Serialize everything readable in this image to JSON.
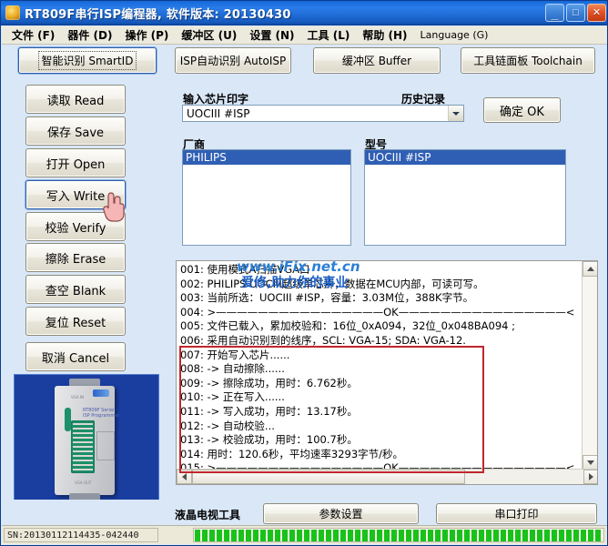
{
  "window": {
    "title": "RT809F串行ISP编程器, 软件版本: 20130430",
    "icon": "app-icon",
    "minimize_label": "_",
    "maximize_label": "□",
    "close_label": "✕"
  },
  "menubar": {
    "items": [
      {
        "label": "文件 (F)",
        "latin": false
      },
      {
        "label": "器件 (D)",
        "latin": false
      },
      {
        "label": "操作 (P)",
        "latin": false
      },
      {
        "label": "缓冲区 (U)",
        "latin": false
      },
      {
        "label": "设置 (N)",
        "latin": false
      },
      {
        "label": "工具 (L)",
        "latin": false
      },
      {
        "label": "帮助 (H)",
        "latin": false
      },
      {
        "label": "Language (G)",
        "latin": true
      }
    ]
  },
  "toolbar": {
    "smartid": "智能识别 SmartID",
    "autoisp": "ISP自动识别 AutoISP",
    "buffer": "缓冲区 Buffer",
    "toolchain": "工具链面板 Toolchain"
  },
  "sidebar": {
    "buttons": [
      {
        "label": "读取 Read"
      },
      {
        "label": "保存 Save"
      },
      {
        "label": "打开 Open"
      },
      {
        "label": "写入 Write"
      },
      {
        "label": "校验 Verify"
      },
      {
        "label": "擦除 Erase"
      },
      {
        "label": "查空 Blank"
      },
      {
        "label": "复位 Reset"
      },
      {
        "label": "取消 Cancel"
      }
    ]
  },
  "chip_panel": {
    "input_label": "输入芯片印字",
    "history_label": "历史记录",
    "combo_value": "UOCIII #ISP",
    "ok_button": "确定 OK",
    "vendor_label": "厂商",
    "model_label": "型号",
    "vendors": [
      "PHILIPS"
    ],
    "vendor_selected": "PHILIPS",
    "models": [
      "UOCIII #ISP"
    ],
    "model_selected": "UOCIII #ISP"
  },
  "log": {
    "watermark_line1": "www.iFix.net.cn",
    "watermark_line2": "爱修,助力你的事业",
    "lines": [
      "001: 使用模式A扫描VGA口",
      "002: PHILIPS UOCIII超级单芯片，数据在MCU内部，可读可写。",
      "003: 当前所选：UOCIII #ISP，容量：3.03M位，388K字节。",
      "004: >————————————————OK————————————————<",
      "005: 文件已载入，累加校验和：16位_0xA094，32位_0x048BA094 ;",
      "006: 采用自动识别到的线序，SCL: VGA-15; SDA: VGA-12.",
      "007: 开始写入芯片......",
      "008: -> 自动擦除......",
      "009: -> 擦除成功，用时：6.762秒。",
      "010: -> 正在写入......",
      "011: -> 写入成功，用时：13.17秒。",
      "012: -> 自动校验...",
      "013: -> 校验成功，用时：100.7秒。",
      "014: 用时：120.6秒，平均速率3293字节/秒。",
      "015: >————————————————OK————————————————<"
    ]
  },
  "bottom": {
    "lcd_tool_label": "液晶电视工具",
    "params_button": "参数设置",
    "serial_print_button": "串口打印"
  },
  "statusbar": {
    "serial_number": "SN:20130112114435-042440",
    "progress_percent": 100
  },
  "colors": {
    "title_blue": "#1a6ede",
    "selection_blue": "#2f5fb4",
    "highlight_red": "#c0272d",
    "progress_green": "#19c21a",
    "panel_bg": "#d9e7f7"
  }
}
